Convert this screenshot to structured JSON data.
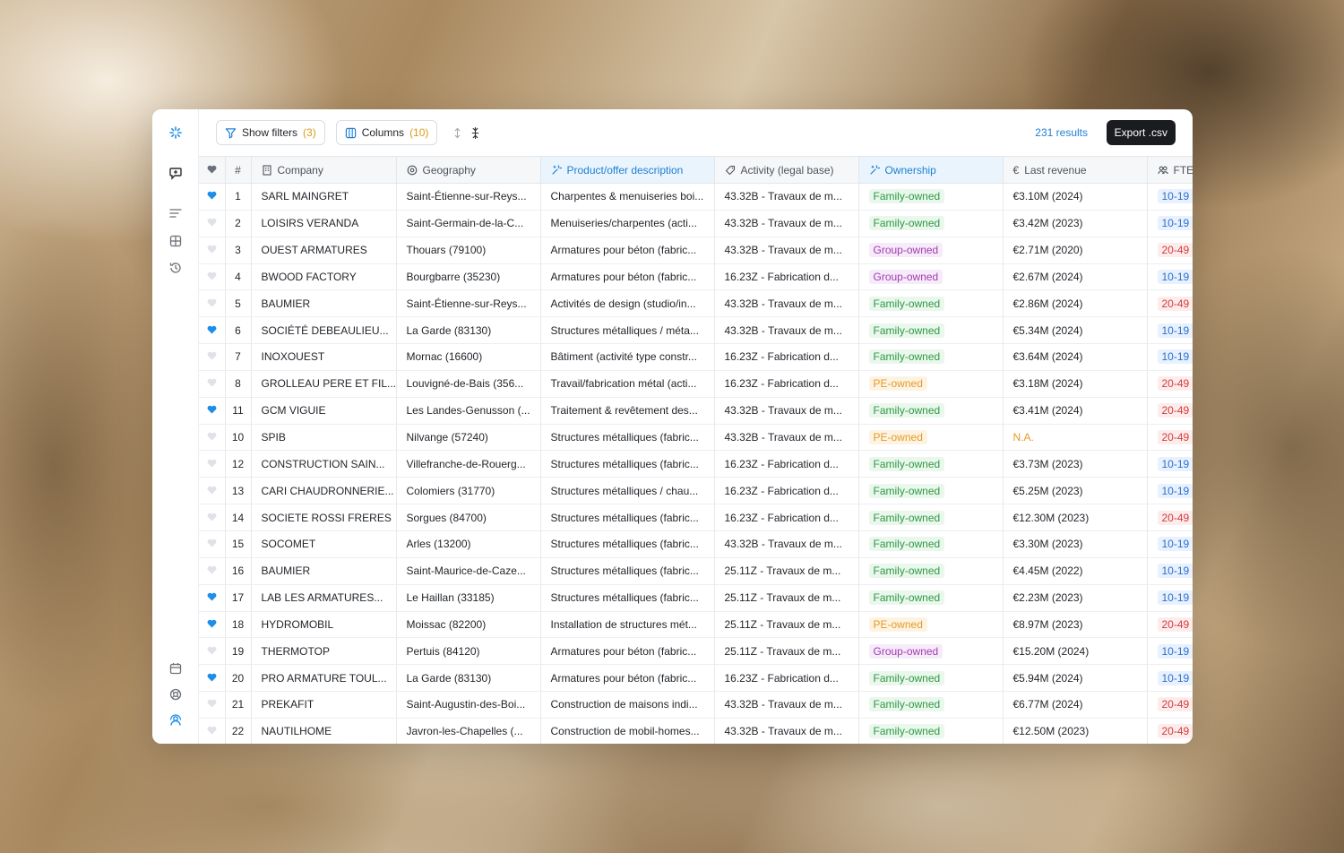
{
  "toolbar": {
    "show_filters_label": "Show filters",
    "filters_count": "(3)",
    "columns_label": "Columns",
    "columns_count": "(10)",
    "results": "231 results",
    "export_label": "Export .csv"
  },
  "rail": {
    "top_icons": [
      "logo-icon",
      "chat-icon",
      "list-icon",
      "grid-icon",
      "history-icon"
    ],
    "bottom_icons": [
      "calendar-icon",
      "support-icon",
      "profile-icon"
    ]
  },
  "columns": {
    "favorite": "",
    "num": "#",
    "company": "Company",
    "geography": "Geography",
    "product": "Product/offer description",
    "activity": "Activity (legal base)",
    "ownership": "Ownership",
    "revenue": "Last revenue",
    "fte": "FTE"
  },
  "colors": {
    "accent": "#1f7fd1",
    "family": "#2f9a44",
    "group": "#a33bb3",
    "pe": "#e59b25",
    "favorite": "#1f8ee8"
  },
  "rows": [
    {
      "fav": true,
      "num": "1",
      "company": "SARL MAINGRET",
      "geo": "Saint-Étienne-sur-Reys...",
      "product": "Charpentes & menuiseries boi...",
      "activity": "43.32B - Travaux de m...",
      "ownership": "Family-owned",
      "own_type": "family",
      "revenue": "€3.10M (2024)",
      "fte": "10-19",
      "fte_type": "blue"
    },
    {
      "fav": false,
      "num": "2",
      "company": "LOISIRS VERANDA",
      "geo": "Saint-Germain-de-la-C...",
      "product": "Menuiseries/charpentes (acti...",
      "activity": "43.32B - Travaux de m...",
      "ownership": "Family-owned",
      "own_type": "family",
      "revenue": "€3.42M (2023)",
      "fte": "10-19",
      "fte_type": "blue"
    },
    {
      "fav": false,
      "num": "3",
      "company": "OUEST ARMATURES",
      "geo": "Thouars (79100)",
      "product": "Armatures pour béton (fabric...",
      "activity": "43.32B - Travaux de m...",
      "ownership": "Group-owned",
      "own_type": "group",
      "revenue": "€2.71M (2020)",
      "fte": "20-49",
      "fte_type": "red"
    },
    {
      "fav": false,
      "num": "4",
      "company": "BWOOD FACTORY",
      "geo": "Bourgbarre (35230)",
      "product": "Armatures pour béton (fabric...",
      "activity": "16.23Z - Fabrication d...",
      "ownership": "Group-owned",
      "own_type": "group",
      "revenue": "€2.67M (2024)",
      "fte": "10-19",
      "fte_type": "blue"
    },
    {
      "fav": false,
      "num": "5",
      "company": "BAUMIER",
      "geo": "Saint-Étienne-sur-Reys...",
      "product": "Activités de design (studio/in...",
      "activity": "43.32B - Travaux de m...",
      "ownership": "Family-owned",
      "own_type": "family",
      "revenue": "€2.86M (2024)",
      "fte": "20-49",
      "fte_type": "red"
    },
    {
      "fav": true,
      "num": "6",
      "company": "SOCIÉTÉ DEBEAULIEU...",
      "geo": "La Garde (83130)",
      "product": "Structures métalliques / méta...",
      "activity": "43.32B - Travaux de m...",
      "ownership": "Family-owned",
      "own_type": "family",
      "revenue": "€5.34M (2024)",
      "fte": "10-19",
      "fte_type": "blue"
    },
    {
      "fav": false,
      "num": "7",
      "company": "INOXOUEST",
      "geo": "Mornac (16600)",
      "product": "Bâtiment (activité type constr...",
      "activity": "16.23Z - Fabrication d...",
      "ownership": "Family-owned",
      "own_type": "family",
      "revenue": "€3.64M (2024)",
      "fte": "10-19",
      "fte_type": "blue"
    },
    {
      "fav": false,
      "num": "8",
      "company": "GROLLEAU PERE ET FIL...",
      "geo": "Louvigné-de-Bais (356...",
      "product": "Travail/fabrication métal (acti...",
      "activity": "16.23Z - Fabrication d...",
      "ownership": "PE-owned",
      "own_type": "pe",
      "revenue": "€3.18M (2024)",
      "fte": "20-49",
      "fte_type": "red"
    },
    {
      "fav": true,
      "num": "11",
      "company": "GCM VIGUIE",
      "geo": "Les Landes-Genusson (...",
      "product": "Traitement & revêtement des...",
      "activity": "43.32B - Travaux de m...",
      "ownership": "Family-owned",
      "own_type": "family",
      "revenue": "€3.41M (2024)",
      "fte": "20-49",
      "fte_type": "red"
    },
    {
      "fav": false,
      "num": "10",
      "company": "SPIB",
      "geo": "Nilvange (57240)",
      "product": "Structures métalliques (fabric...",
      "activity": "43.32B - Travaux de m...",
      "ownership": "PE-owned",
      "own_type": "pe",
      "revenue": "N.A.",
      "revenue_na": true,
      "fte": "20-49",
      "fte_type": "red"
    },
    {
      "fav": false,
      "num": "12",
      "company": "CONSTRUCTION SAIN...",
      "geo": "Villefranche-de-Rouerg...",
      "product": "Structures métalliques (fabric...",
      "activity": "16.23Z - Fabrication d...",
      "ownership": "Family-owned",
      "own_type": "family",
      "revenue": "€3.73M (2023)",
      "fte": "10-19",
      "fte_type": "blue"
    },
    {
      "fav": false,
      "num": "13",
      "company": "CARI CHAUDRONNERIE...",
      "geo": "Colomiers (31770)",
      "product": "Structures métalliques / chau...",
      "activity": "16.23Z - Fabrication d...",
      "ownership": "Family-owned",
      "own_type": "family",
      "revenue": "€5.25M (2023)",
      "fte": "10-19",
      "fte_type": "blue"
    },
    {
      "fav": false,
      "num": "14",
      "company": "SOCIETE ROSSI FRERES",
      "geo": "Sorgues (84700)",
      "product": "Structures métalliques (fabric...",
      "activity": "16.23Z - Fabrication d...",
      "ownership": "Family-owned",
      "own_type": "family",
      "revenue": "€12.30M (2023)",
      "fte": "20-49",
      "fte_type": "red"
    },
    {
      "fav": false,
      "num": "15",
      "company": "SOCOMET",
      "geo": "Arles (13200)",
      "product": "Structures métalliques (fabric...",
      "activity": "43.32B - Travaux de m...",
      "ownership": "Family-owned",
      "own_type": "family",
      "revenue": "€3.30M (2023)",
      "fte": "10-19",
      "fte_type": "blue"
    },
    {
      "fav": false,
      "num": "16",
      "company": "BAUMIER",
      "geo": "Saint-Maurice-de-Caze...",
      "product": "Structures métalliques (fabric...",
      "activity": "25.11Z - Travaux de m...",
      "ownership": "Family-owned",
      "own_type": "family",
      "revenue": "€4.45M (2022)",
      "fte": "10-19",
      "fte_type": "blue"
    },
    {
      "fav": true,
      "num": "17",
      "company": "LAB LES ARMATURES...",
      "geo": "Le Haillan (33185)",
      "product": "Structures métalliques (fabric...",
      "activity": "25.11Z - Travaux de m...",
      "ownership": "Family-owned",
      "own_type": "family",
      "revenue": "€2.23M (2023)",
      "fte": "10-19",
      "fte_type": "blue"
    },
    {
      "fav": true,
      "num": "18",
      "company": "HYDROMOBIL",
      "geo": "Moissac (82200)",
      "product": "Installation de structures mét...",
      "activity": "25.11Z - Travaux de m...",
      "ownership": "PE-owned",
      "own_type": "pe",
      "revenue": "€8.97M (2023)",
      "fte": "20-49",
      "fte_type": "red"
    },
    {
      "fav": false,
      "num": "19",
      "company": "THERMOTOP",
      "geo": "Pertuis (84120)",
      "product": "Armatures pour béton (fabric...",
      "activity": "25.11Z - Travaux de m...",
      "ownership": "Group-owned",
      "own_type": "group",
      "revenue": "€15.20M (2024)",
      "fte": "10-19",
      "fte_type": "blue"
    },
    {
      "fav": true,
      "num": "20",
      "company": "PRO ARMATURE TOUL...",
      "geo": "La Garde (83130)",
      "product": "Armatures pour béton (fabric...",
      "activity": "16.23Z - Fabrication d...",
      "ownership": "Family-owned",
      "own_type": "family",
      "revenue": "€5.94M (2024)",
      "fte": "10-19",
      "fte_type": "blue"
    },
    {
      "fav": false,
      "num": "21",
      "company": "PREKAFIT",
      "geo": "Saint-Augustin-des-Boi...",
      "product": "Construction de maisons indi...",
      "activity": "43.32B - Travaux de m...",
      "ownership": "Family-owned",
      "own_type": "family",
      "revenue": "€6.77M (2024)",
      "fte": "20-49",
      "fte_type": "red"
    },
    {
      "fav": false,
      "num": "22",
      "company": "NAUTILHOME",
      "geo": "Javron-les-Chapelles (...",
      "product": "Construction de mobil-homes...",
      "activity": "43.32B - Travaux de m...",
      "ownership": "Family-owned",
      "own_type": "family",
      "revenue": "€12.50M (2023)",
      "fte": "20-49",
      "fte_type": "red"
    }
  ]
}
